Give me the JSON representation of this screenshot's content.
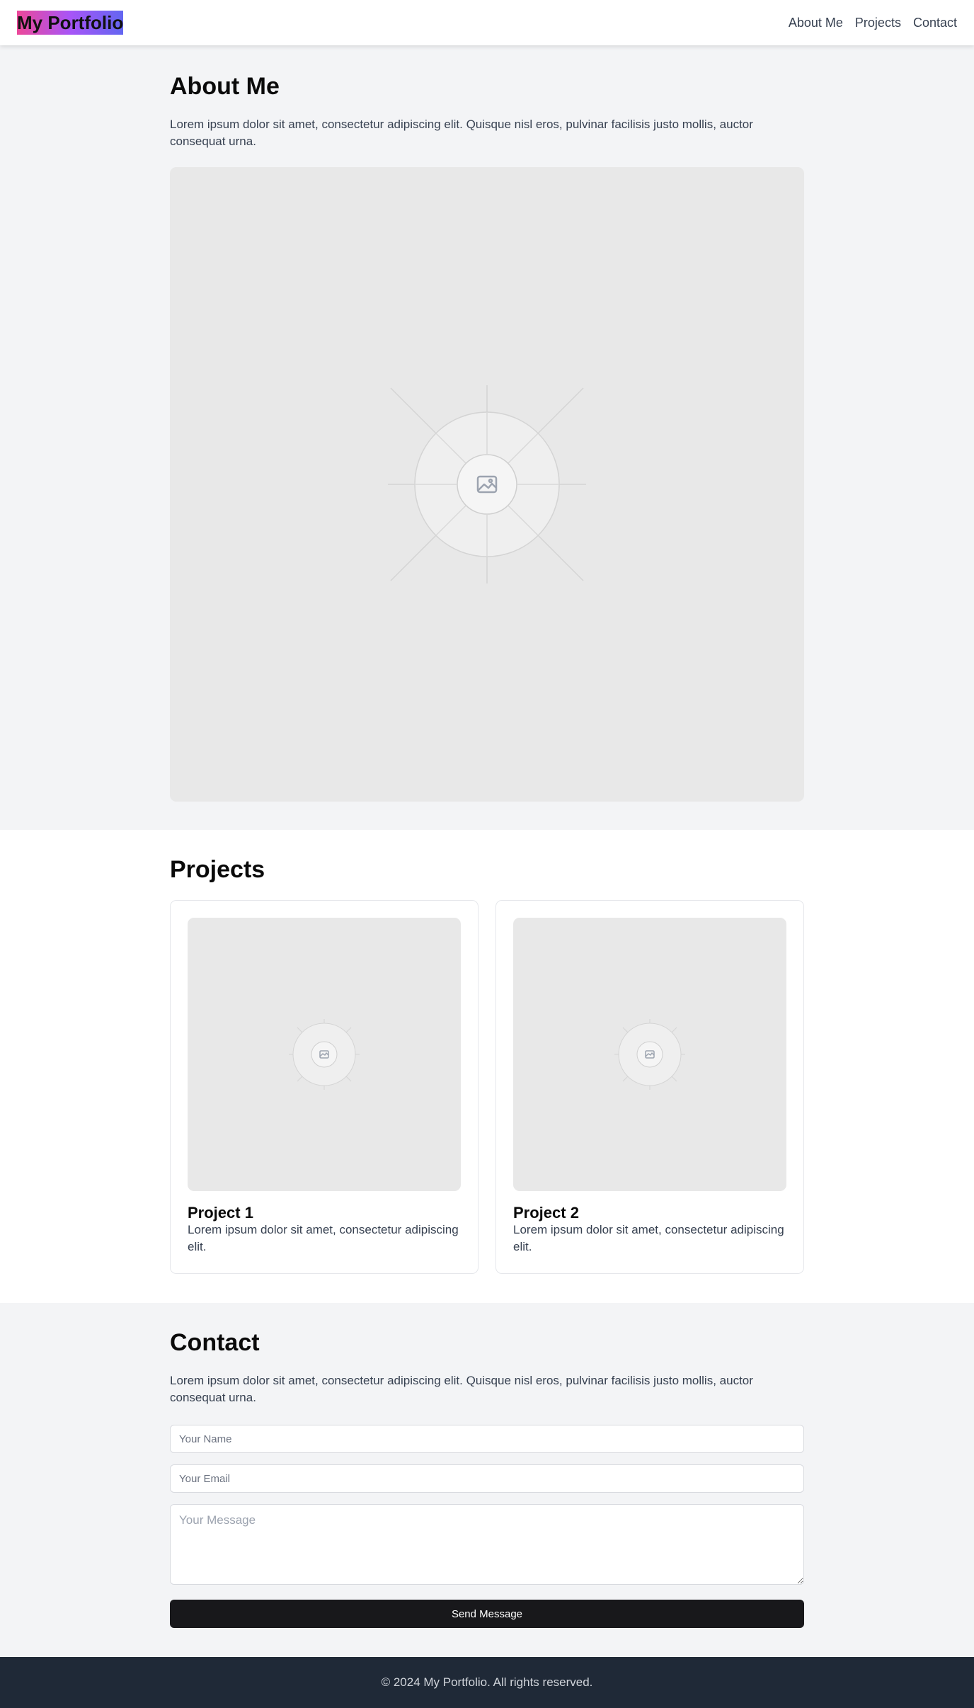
{
  "header": {
    "brand": "My Portfolio",
    "nav": [
      "About Me",
      "Projects",
      "Contact"
    ]
  },
  "about": {
    "title": "About Me",
    "text": "Lorem ipsum dolor sit amet, consectetur adipiscing elit. Quisque nisl eros, pulvinar facilisis justo mollis, auctor consequat urna.",
    "image_icon": "image-placeholder-icon"
  },
  "projects": {
    "title": "Projects",
    "items": [
      {
        "title": "Project 1",
        "text": "Lorem ipsum dolor sit amet, consectetur adipiscing elit."
      },
      {
        "title": "Project 2",
        "text": "Lorem ipsum dolor sit amet, consectetur adipiscing elit."
      }
    ]
  },
  "contact": {
    "title": "Contact",
    "text": "Lorem ipsum dolor sit amet, consectetur adipiscing elit. Quisque nisl eros, pulvinar facilisis justo mollis, auctor consequat urna.",
    "name_placeholder": "Your Name",
    "email_placeholder": "Your Email",
    "message_placeholder": "Your Message",
    "send_label": "Send Message"
  },
  "footer": {
    "text": "© 2024 My Portfolio. All rights reserved."
  },
  "colors": {
    "brand_gradient": [
      "#ec4899",
      "#a855f7",
      "#6366f1"
    ],
    "button_bg": "#18181b",
    "footer_bg": "#1f2937",
    "section_bg": "#f3f4f6"
  }
}
